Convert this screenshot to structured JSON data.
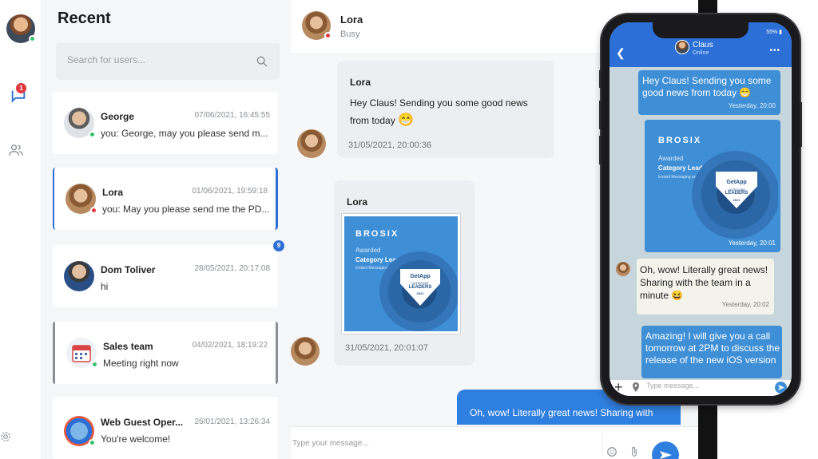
{
  "recent": {
    "title": "Recent",
    "search_placeholder": "Search for users...",
    "rail_badge": "1",
    "conversations": [
      {
        "name": "George",
        "time": "07/06/2021, 16:45:55",
        "preview": "you: George, may you please send m...",
        "status_color": "#37c06c"
      },
      {
        "name": "Lora",
        "time": "01/06/2021, 19:59:18",
        "preview": "you: May you please send me the PD...",
        "status_color": "#e0383e"
      },
      {
        "name": "Dom Toliver",
        "time": "28/05/2021, 20:17:08",
        "preview": "hi",
        "unread": "9"
      },
      {
        "name": "Sales team",
        "time": "04/02/2021, 18:19:22",
        "preview": "Meeting right now",
        "status_color": "#37c06c"
      },
      {
        "name": "Web Guest Oper...",
        "time": "26/01/2021, 13:26:34",
        "preview": "You're welcome!",
        "status_color": "#37c06c"
      }
    ]
  },
  "conversation": {
    "name": "Lora",
    "status": "Busy",
    "messages": [
      {
        "sender": "Lora",
        "text": "Hey Claus! Sending you some good news from today",
        "emoji": "😁",
        "time": "31/05/2021, 20:00:36"
      },
      {
        "sender": "Lora",
        "time": "31/05/2021, 20:01:07"
      }
    ],
    "outgoing_text": "Oh, wow! Literally great news! Sharing with",
    "composer_placeholder": "Type your message..."
  },
  "award": {
    "brand": "BROSIX",
    "line1": "Awarded",
    "line2": "Category Leader",
    "line3": "Instant Messaging and Chat",
    "badge_top": "GetApp",
    "badge_mid": "CATEGORY",
    "badge_main": "LEADERS",
    "badge_year": "2021"
  },
  "phone": {
    "battery": "55% ▮",
    "contact_name": "Claus",
    "contact_status": "Online",
    "menu": "•••",
    "messages": [
      {
        "text": "Hey Claus! Sending you some good news from today",
        "emoji": "😁",
        "time": "Yesterday, 20:00"
      },
      {
        "time": "Yesterday, 20:01"
      },
      {
        "text": "Oh, wow! Literally great news! Sharing with the team in a minute",
        "emoji": "😆",
        "time": "Yesterday, 20:02"
      },
      {
        "text": "Amazing! I will give you a call tomorrow at 2PM to discuss the release of the new iOS version"
      }
    ],
    "input_placeholder": "Type message..."
  },
  "colors": {
    "accent": "#2c6fd6",
    "bubble_out": "#3f8fd6",
    "online": "#37c06c",
    "busy": "#e0383e"
  }
}
